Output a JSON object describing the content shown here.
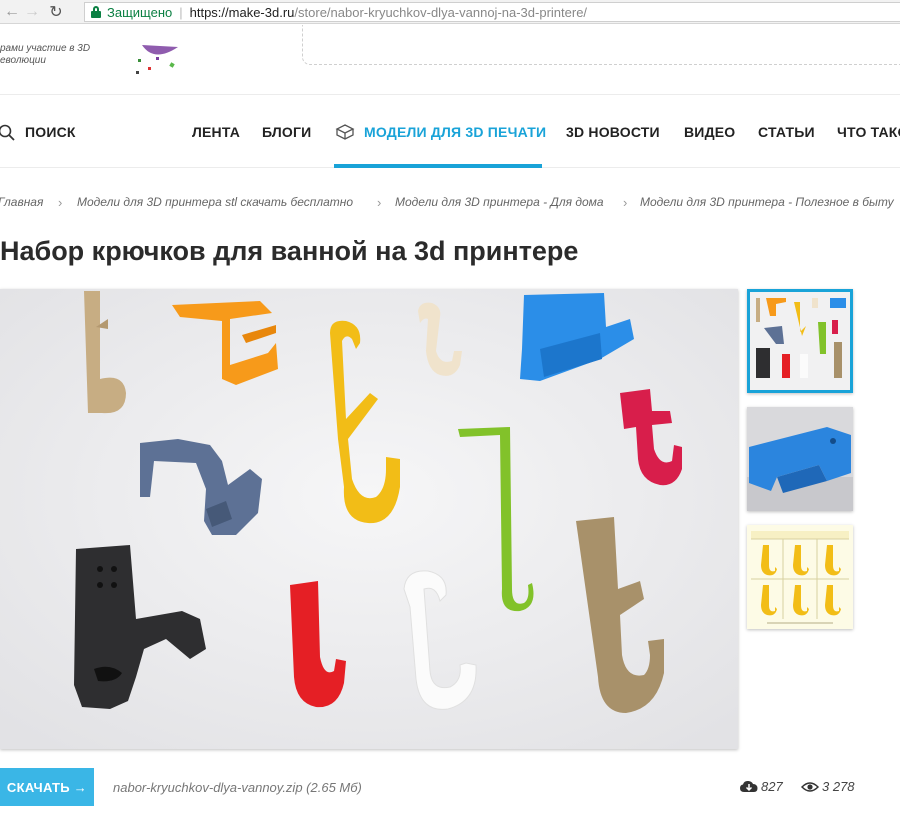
{
  "browser": {
    "secure_label": "Защищено",
    "url_host": "https://make-3d.ru",
    "url_path": "/store/nabor-kryuchkov-dlya-vannoj-na-3d-printere/"
  },
  "promo": {
    "line1": "рами участие в 3D",
    "line2": "еволюции"
  },
  "nav": {
    "search": "ПОИСК",
    "items": [
      {
        "label": "ЛЕНТА"
      },
      {
        "label": "БЛОГИ"
      },
      {
        "label": "МОДЕЛИ ДЛЯ 3D ПЕЧАТИ"
      },
      {
        "label": "3D НОВОСТИ"
      },
      {
        "label": "ВИДЕО"
      },
      {
        "label": "СТАТЬИ"
      },
      {
        "label": "ЧТО ТАКО"
      }
    ]
  },
  "breadcrumb": [
    {
      "label": "Главная"
    },
    {
      "label": "Модели для 3D принтера stl скачать бесплатно"
    },
    {
      "label": "Модели для 3D принтера - Для дома"
    },
    {
      "label": "Модели для 3D принтера - Полезное в быту"
    }
  ],
  "title": "Набор крючков для ванной на 3d принтере",
  "download": {
    "button_label": "СКАЧАТЬ →",
    "file_name": "nabor-kryuchkov-dlya-vannoy.zip (2.65 Мб)",
    "downloads": "827",
    "views": "3 278"
  },
  "icons": {
    "search": "search-icon",
    "lock": "lock-icon",
    "download": "cloud-download-icon",
    "views": "eye-icon",
    "models": "cube-icon"
  },
  "colors": {
    "accent": "#19a3d8",
    "button": "#3ab6e6",
    "secure": "#0b8043"
  }
}
